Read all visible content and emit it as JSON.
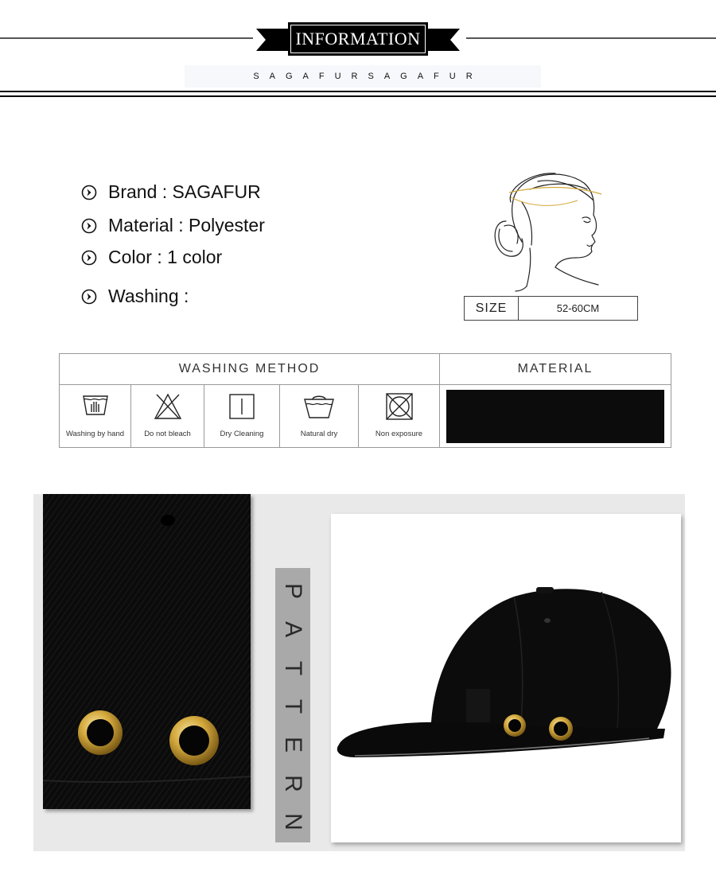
{
  "header": {
    "title": "INFORMATION",
    "tagline": "SAGAFURSAGAFUR"
  },
  "info": {
    "brand": "Brand : SAGAFUR",
    "material": "Material : Polyester",
    "color": "Color : 1 color",
    "washing": "Washing :"
  },
  "size": {
    "label": "SIZE",
    "value": "52-60CM"
  },
  "washing_table": {
    "method_header": "WASHING METHOD",
    "material_header": "MATERIAL",
    "items": [
      {
        "label": "Washing by hand",
        "icon": "hand-wash-icon"
      },
      {
        "label": "Do not bleach",
        "icon": "no-bleach-icon"
      },
      {
        "label": "Dry Cleaning",
        "icon": "dry-clean-icon"
      },
      {
        "label": "Natural dry",
        "icon": "natural-dry-icon"
      },
      {
        "label": "Non exposure",
        "icon": "no-sun-icon"
      }
    ]
  },
  "pattern": {
    "letters": [
      "P",
      "A",
      "T",
      "T",
      "E",
      "R",
      "N"
    ]
  },
  "colors": {
    "fabric": "#0c0c0c",
    "brass": "#d4a93c",
    "panel": "#e9e9e9",
    "pattern_bar": "#a9a9a9"
  }
}
